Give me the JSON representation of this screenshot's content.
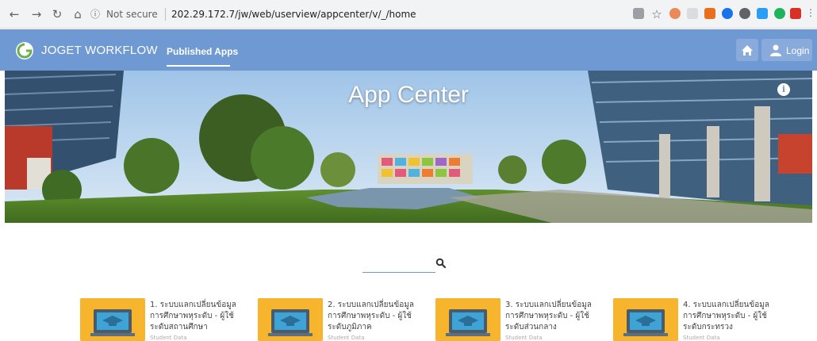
{
  "browser": {
    "security_label": "Not secure",
    "url": "202.29.172.7/jw/web/userview/appcenter/v/_/home"
  },
  "header": {
    "brand": "JOGET WORKFLOW",
    "nav_published": "Published Apps",
    "login_label": "Login",
    "color": "#6f99d3"
  },
  "banner": {
    "title": "App Center"
  },
  "search": {
    "value": "",
    "placeholder": ""
  },
  "apps": [
    {
      "title": "1. ระบบแลกเปลี่ยนข้อมูลการศึกษาพหุระดับ - ผู้ใช้ระดับสถานศึกษา",
      "sub": "Student Data"
    },
    {
      "title": "2. ระบบแลกเปลี่ยนข้อมูลการศึกษาพหุระดับ - ผู้ใช้ระดับภูมิภาค",
      "sub": "Student Data"
    },
    {
      "title": "3. ระบบแลกเปลี่ยนข้อมูลการศึกษาพหุระดับ - ผู้ใช้ระดับส่วนกลาง",
      "sub": "Student Data"
    },
    {
      "title": "4. ระบบแลกเปลี่ยนข้อมูลการศึกษาพหุระดับ - ผู้ใช้ระดับกระทรวง",
      "sub": "Student Data"
    }
  ],
  "icons": {
    "back": "arrow-left-icon",
    "forward": "arrow-right-icon",
    "reload": "reload-icon",
    "home_browser": "home-icon",
    "star": "star-icon",
    "app_home": "home-icon",
    "user": "user-icon",
    "info": "info-icon",
    "search": "search-icon"
  }
}
